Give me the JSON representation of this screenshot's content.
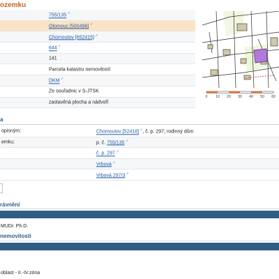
{
  "section1": {
    "title": "ozemku",
    "rows": [
      {
        "label": "",
        "value": "755/135",
        "link": true
      },
      {
        "label": "",
        "value": "Olomouc [500496]",
        "link": true
      },
      {
        "label": "",
        "value": "Chomoutov [652415]",
        "link": true
      },
      {
        "label": "",
        "value": "644",
        "link": true
      },
      {
        "label": "",
        "value": "141",
        "link": false
      },
      {
        "label": "",
        "value": "Parcela katastru nemovitostí",
        "link": false
      },
      {
        "label": "",
        "value": "DKM",
        "link": true
      },
      {
        "label": "",
        "value": "Ze souřadnic v S-JTSK",
        "link": false
      },
      {
        "label": "",
        "value": "zastavěná plocha a nádvoří",
        "link": false
      }
    ],
    "ext_mark": "↗"
  },
  "map": {
    "scale_labels": [
      "0",
      "10",
      "20",
      "30",
      "40",
      "50",
      "60"
    ],
    "colors": {
      "parcel": "#b07ad6",
      "building": "#cfc9a8",
      "line": "#2a2a2a",
      "green": "#d8e8a8",
      "red": "#e05050"
    }
  },
  "section2": {
    "title": "a",
    "rows": [
      {
        "label": "opisným:",
        "value_link": "Chomoutov [52418]",
        "value_rest": ", č. p. 297; rodinný dům"
      },
      {
        "label": "emku:",
        "value_prefix": "p. č.",
        "value_link": "755/135",
        "value_rest": ""
      },
      {
        "label": "",
        "value_link": "č. p. 297",
        "value_rest": ""
      },
      {
        "label": "",
        "value_link": "Vrbová",
        "value_rest": ""
      },
      {
        "label": "",
        "value_link": "Vrbová 297/3",
        "value_rest": ""
      }
    ]
  },
  "section3": {
    "title": "rávnění",
    "owner": "MUDr. Ph.D."
  },
  "section4": {
    "title": "nemovitosti",
    "line": "oblast - II.-IV.zóna"
  }
}
